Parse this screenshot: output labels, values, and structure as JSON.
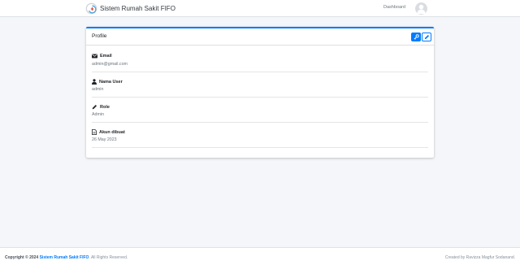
{
  "navbar": {
    "brand": "Sistem Rumah Sakit FIFO",
    "link": "Dashboard",
    "avatar_icon": "user-avatar-icon"
  },
  "card": {
    "title": "Profile",
    "accent": "#007bff",
    "actions": [
      {
        "icon": "key-icon"
      },
      {
        "icon": "pencil-icon"
      }
    ],
    "items": [
      {
        "icon": "envelope-icon",
        "label": "Email",
        "value": "admin@gmail.com"
      },
      {
        "icon": "user-icon",
        "label": "Nama User",
        "value": "admin"
      },
      {
        "icon": "pen-icon",
        "label": "Role",
        "value": "Admin"
      },
      {
        "icon": "file-icon",
        "label": "Akun dibuat",
        "value": "26 May 2023"
      }
    ]
  },
  "footer": {
    "copyright_prefix": "Copyright © 2024",
    "brand_link": "Sistem Rumah Sakit FIFO",
    "rights": ". All Rights Reserved.",
    "credit": "Created by Ravizza Magfur Sodanand."
  }
}
